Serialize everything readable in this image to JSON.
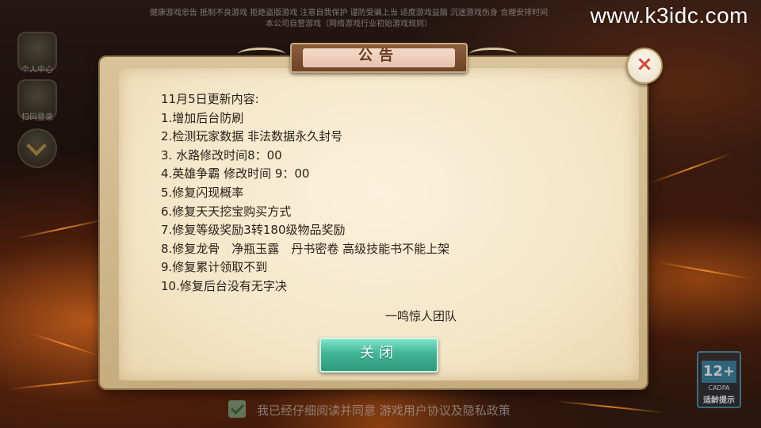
{
  "watermark": "www.k3idc.com",
  "top_notice": {
    "line1": "健康游戏忠告 抵制不良游戏 拒绝盗版游戏 注意自我保护 谨防受骗上当 适度游戏益脑 沉迷游戏伤身 合理安排时间",
    "line2": "本公司自营游戏（网络游戏行业初始游戏规则）"
  },
  "side_buttons": [
    {
      "label": "个人中心"
    },
    {
      "label": "扫码登录"
    },
    {
      "label": ""
    }
  ],
  "dialog": {
    "title": "公告",
    "heading": "11月5日更新内容:",
    "items": [
      "1.增加后台防刷",
      "2.检测玩家数据 非法数据永久封号",
      "3. 水路修改时间8：00",
      "4.英雄争霸 修改时间 9：00",
      "5.修复闪现概率",
      "6.修复天天挖宝购买方式",
      "7.修复等级奖励3转180级物品奖励",
      "8.修复龙骨　净瓶玉露　丹书密卷 高级技能书不能上架",
      "9.修复累计领取不到",
      "10.修复后台没有无字决"
    ],
    "signature": "一鸣惊人团队",
    "close_button_label": "关闭",
    "close_icon": "×"
  },
  "agreement": {
    "text": "我已经仔细阅读并同意 游戏用户协议及隐私政策",
    "checked": true
  },
  "age_rating": {
    "number": "12+",
    "sub": "CADPA",
    "tip": "适龄提示"
  },
  "colors": {
    "paper": "#f4e6c8",
    "button_green": "#41b596",
    "close_x": "#d8483a",
    "title_text": "#6b3a22"
  },
  "icons": [
    "close-icon",
    "checkbox-check-icon",
    "chevron-down-icon",
    "user-center-icon",
    "scan-login-icon"
  ]
}
